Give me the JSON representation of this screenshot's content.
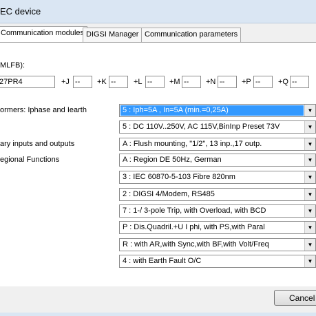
{
  "window": {
    "title": "EC device"
  },
  "tabs": [
    {
      "label": "Communication modules"
    },
    {
      "label": "DIGSI Manager"
    },
    {
      "label": "Communication parameters"
    }
  ],
  "mlfb": {
    "label": "MLFB):",
    "value": "27PR4",
    "options": [
      {
        "prefix": "+J",
        "value": "--"
      },
      {
        "prefix": "+K",
        "value": "--"
      },
      {
        "prefix": "+L",
        "value": "--"
      },
      {
        "prefix": "+M",
        "value": "--"
      },
      {
        "prefix": "+N",
        "value": "--"
      },
      {
        "prefix": "+P",
        "value": "--"
      },
      {
        "prefix": "+Q",
        "value": "--"
      }
    ]
  },
  "fields": [
    {
      "label": "ormers: Iphase and Iearth",
      "value": "5 : Iph=5A , In=5A (min.=0,25A)"
    },
    {
      "label": "",
      "value": "5 : DC 110V..250V, AC 115V,BinInp Preset 73V"
    },
    {
      "label": "ary inputs and outputs",
      "value": "A : Flush mounting,  \"1/2\", 13 inp.,17 outp."
    },
    {
      "label": "egional Functions",
      "value": "A : Region DE 50Hz, German"
    },
    {
      "label": "",
      "value": "3 : IEC 60870-5-103       Fibre 820nm"
    },
    {
      "label": "",
      "value": "2 : DIGSI 4/Modem, RS485"
    },
    {
      "label": "",
      "value": "7 : 1-/ 3-pole Trip, with Overload, with BCD"
    },
    {
      "label": "",
      "value": "P : Dis.Quadril.+U I phi, with PS,with Paral"
    },
    {
      "label": "",
      "value": "R : with AR,with Sync,with BF,with Volt/Freq"
    },
    {
      "label": "",
      "value": "4 : with Earth Fault O/C"
    }
  ],
  "buttons": {
    "cancel": "Cancel"
  },
  "icons": {
    "dropdown": "chevron-down-icon"
  }
}
